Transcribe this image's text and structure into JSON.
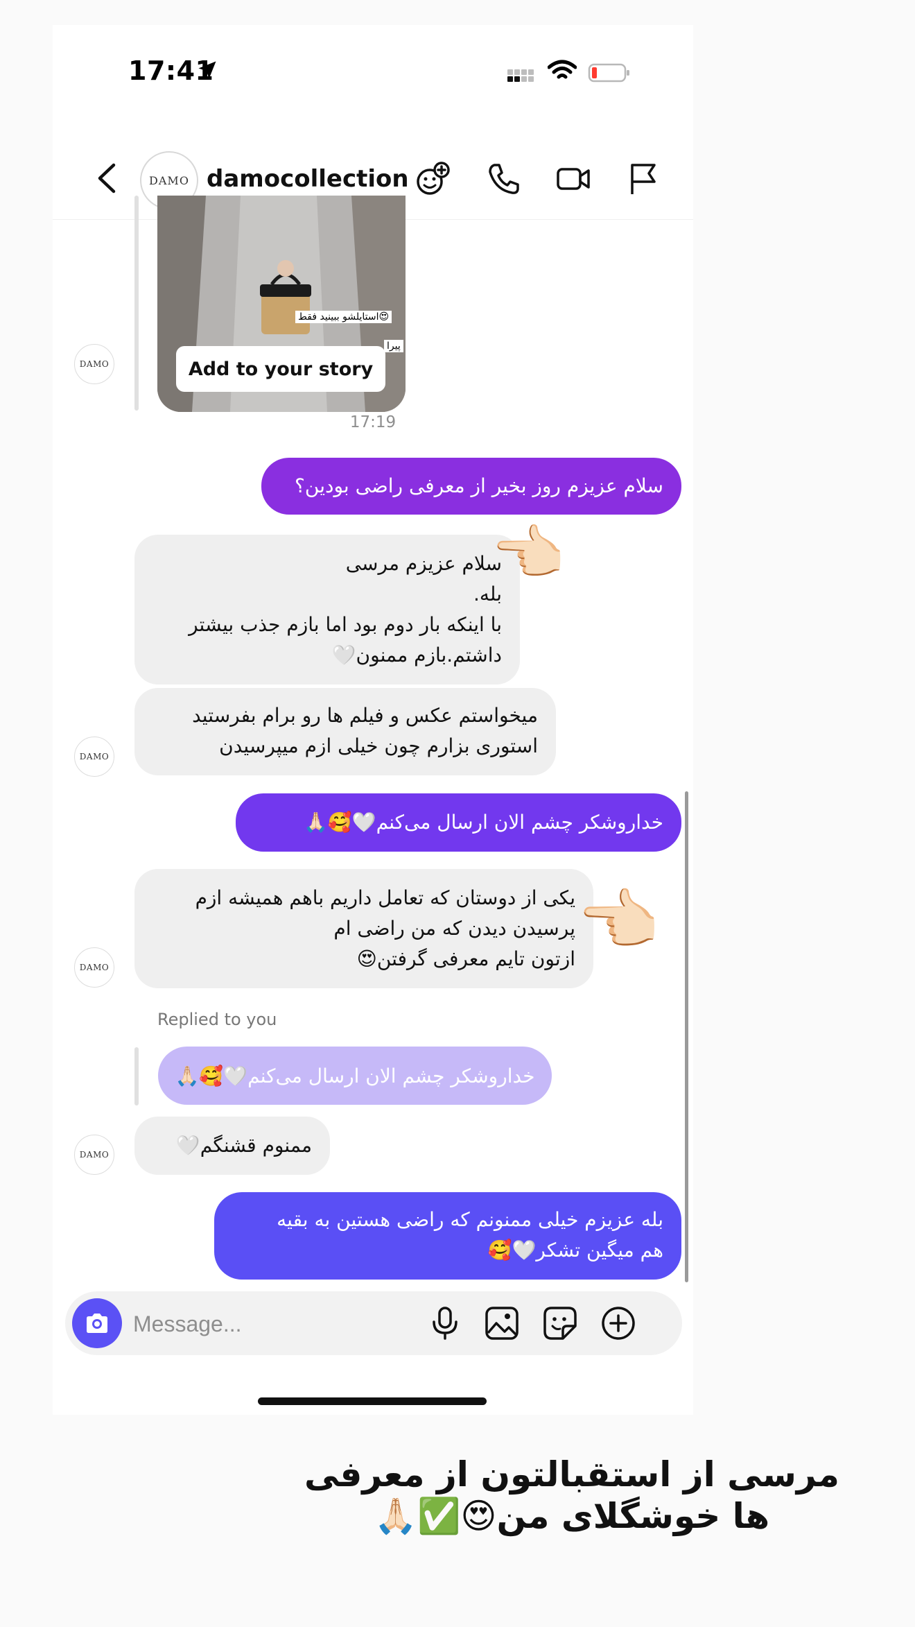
{
  "status_bar": {
    "time": "17:41"
  },
  "header": {
    "username": "damocollection",
    "avatar_text": "DAMO"
  },
  "story": {
    "add_button": "Add to your story",
    "caption_1": "استایلشو ببینید فقط😍",
    "caption_2": "پیرا"
  },
  "thread": {
    "timestamp": "17:19",
    "avatar_text": "DAMO",
    "messages": [
      {
        "from": "me",
        "text": "سلام عزیزم روز بخیر از معرفی راضی بودین؟"
      },
      {
        "from": "them",
        "lines": [
          "سلام عزیزم مرسی",
          "بله.",
          "با اینکه بار دوم بود اما بازم جذب بیشتر",
          "داشتم.بازم ممنون🤍"
        ]
      },
      {
        "from": "them",
        "lines": [
          "میخواستم عکس و فیلم ها رو برام بفرستید",
          "استوری بزارم چون خیلی ازم میپرسیدن"
        ]
      },
      {
        "from": "me",
        "text": "خداروشکر چشم الان ارسال می‌کنم🤍🥰🙏🏻"
      },
      {
        "from": "them",
        "lines": [
          "یکی از دوستان که تعامل داریم باهم همیشه ازم",
          "پرسیدن دیدن که من راضی ام",
          "ازتون تایم معرفی گرفتن😍"
        ]
      },
      {
        "from": "them",
        "text": "ممنوم قشنگم🤍"
      },
      {
        "from": "me",
        "lines": [
          "بله عزیزم خیلی ممنونم که راضی هستین به بقیه",
          "هم میگین تشکر🤍🥰"
        ]
      }
    ],
    "reply_label": "Replied to you",
    "reply_preview": "خداروشکر چشم الان ارسال می‌کنم🤍🥰🙏🏻",
    "pointer_emoji": "👈🏻"
  },
  "composer": {
    "placeholder": "Message..."
  },
  "caption": {
    "line_1": "مرسی از استقبالتون از معرفی",
    "line_2": "ها خوشگلای من😍✅🙏🏻"
  },
  "colors": {
    "outgoing_1": "#8a2fe0",
    "outgoing_2": "#7238ee",
    "outgoing_3": "#5a4ff5",
    "camera": "#5b51f5",
    "incoming": "#efefef"
  },
  "icons": [
    "location-arrow-icon",
    "signal-icon",
    "wifi-icon",
    "battery-icon",
    "back-icon",
    "add-effect-icon",
    "phone-icon",
    "video-icon",
    "flag-icon",
    "camera-icon",
    "mic-icon",
    "gallery-icon",
    "sticker-icon",
    "plus-icon"
  ]
}
